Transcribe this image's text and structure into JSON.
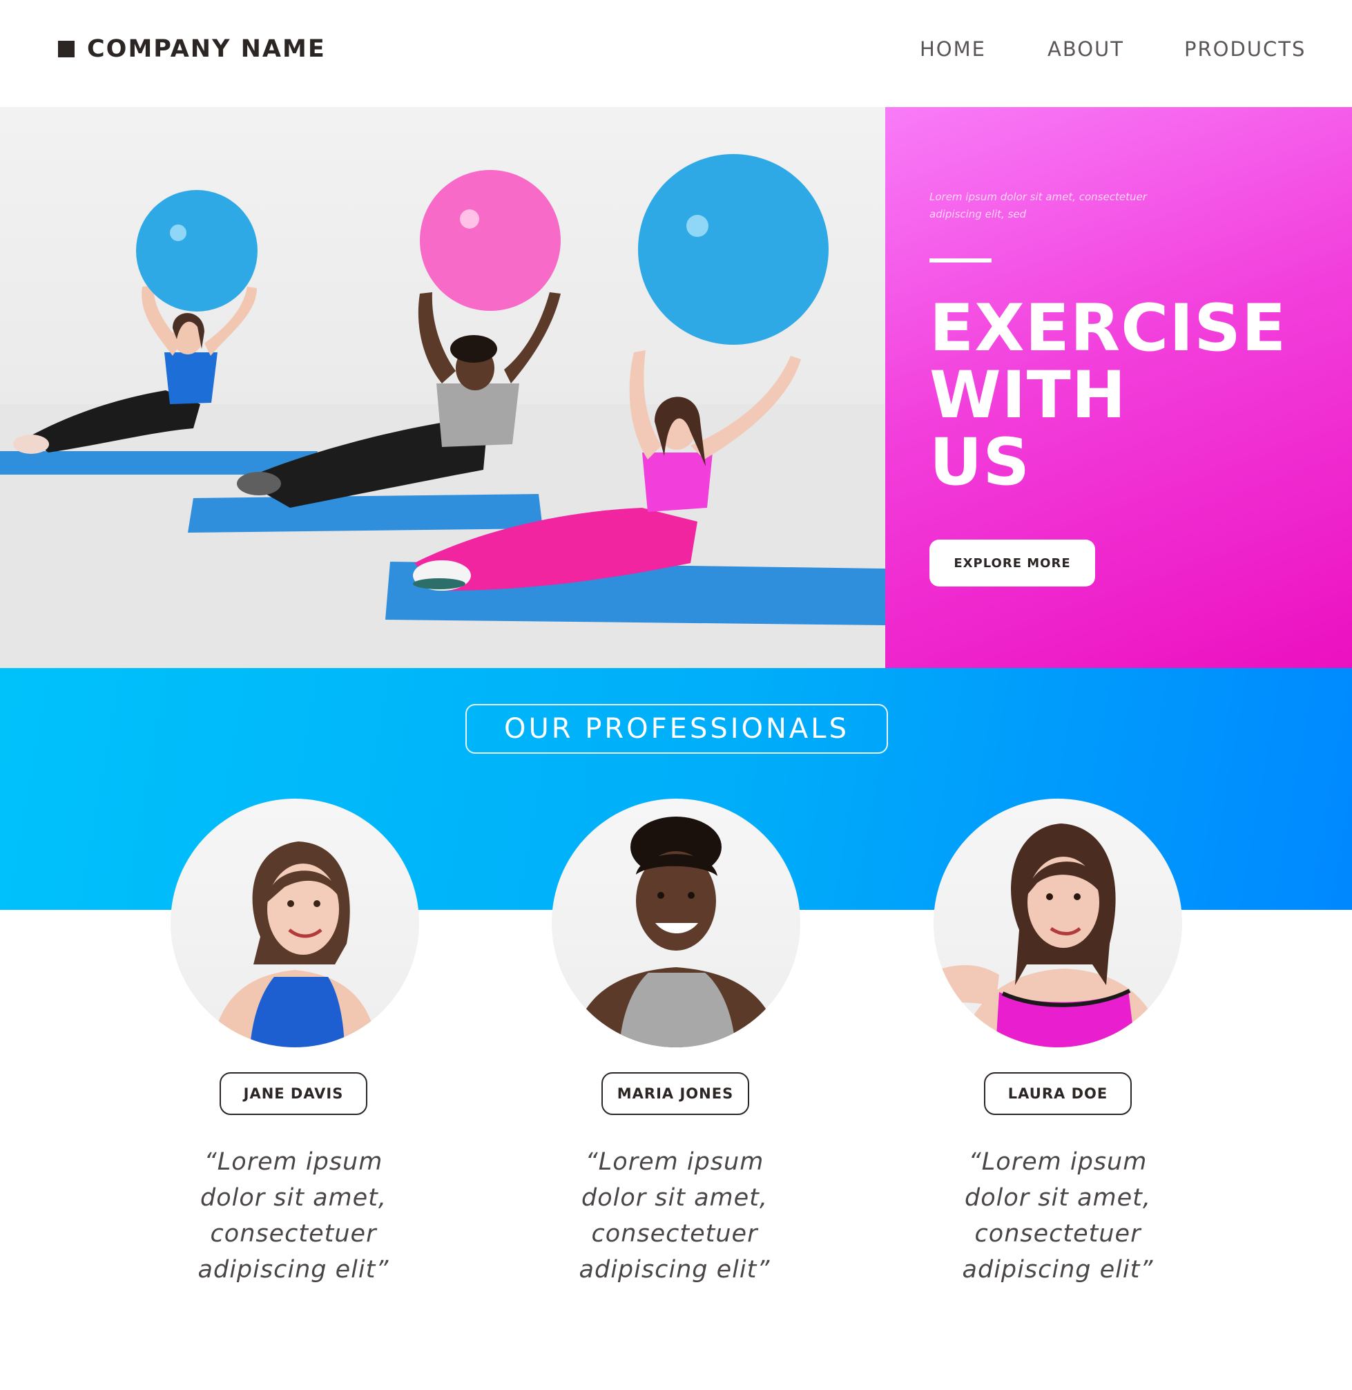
{
  "header": {
    "brand": "COMPANY NAME",
    "nav": [
      {
        "label": "HOME"
      },
      {
        "label": "ABOUT"
      },
      {
        "label": "PRODUCTS"
      }
    ]
  },
  "hero": {
    "tagline": "Lorem ipsum dolor sit amet, consectetuer adipiscing elit, sed",
    "title_lines": [
      "EXERCISE",
      "WITH",
      "US"
    ],
    "cta_label": "EXPLORE MORE"
  },
  "professionals": {
    "heading": "OUR PROFESSIONALS",
    "people": [
      {
        "name": "JANE DAVIS",
        "quote": "“Lorem ipsum dolor sit amet, consectetuer adipiscing elit”"
      },
      {
        "name": "MARIA JONES",
        "quote": "“Lorem ipsum dolor sit amet, consectetuer adipiscing elit”"
      },
      {
        "name": "LAURA DOE",
        "quote": "“Lorem ipsum dolor sit amet, consectetuer adipiscing elit”"
      }
    ]
  },
  "colors": {
    "hero_panel": "#f23fdc",
    "band": "#00adf9",
    "text_dark": "#2b2524",
    "ball_blue": "#2ea9e6",
    "ball_pink": "#f76ac8",
    "mat_blue": "#2f8fdc"
  }
}
